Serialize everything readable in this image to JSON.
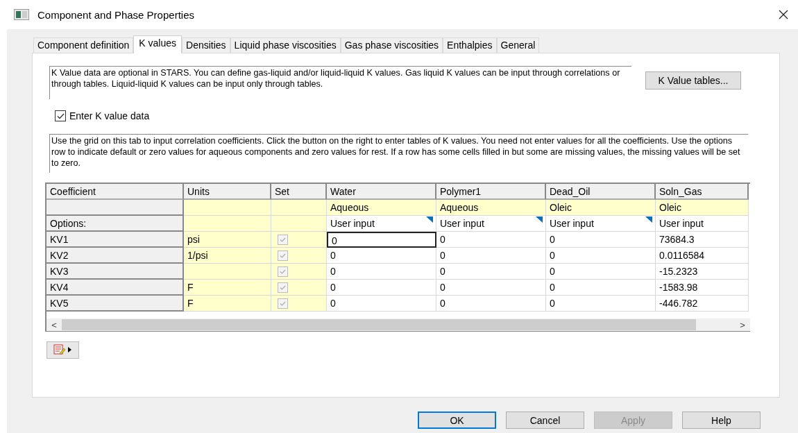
{
  "window": {
    "title": "Component and Phase Properties"
  },
  "tabs": [
    {
      "label": "Component definition",
      "selected": false
    },
    {
      "label": "K values",
      "selected": true
    },
    {
      "label": "Densities",
      "selected": false
    },
    {
      "label": "Liquid phase viscosities",
      "selected": false
    },
    {
      "label": "Gas phase viscosities",
      "selected": false
    },
    {
      "label": "Enthalpies",
      "selected": false
    },
    {
      "label": "General",
      "selected": false
    }
  ],
  "intro": "K Value data are optional in STARS. You can define gas-liquid and/or liquid-liquid K values. Gas liquid K values can be input through correlations or through tables. Liquid-liquid K values can be input only through tables.",
  "tables_button": "K Value tables...",
  "enter_checkbox": {
    "label": "Enter K value data",
    "checked": true
  },
  "grid_help": "Use the grid on this tab to input correlation coefficients. Click the button on the right to enter tables of K values. You need not enter values for all the coefficients. Use the options row to indicate default or zero values for aqueous components and zero values for rest. If a row has some cells filled in but some are missing values, the missing values will be set to zero.",
  "grid": {
    "fixed_headers": [
      "Coefficient",
      "Units",
      "Set"
    ],
    "options_label": "Options:",
    "components": [
      {
        "name": "Water",
        "phase": "Aqueous",
        "option": "User input",
        "dropdown": true
      },
      {
        "name": "Polymer1",
        "phase": "Aqueous",
        "option": "User input",
        "dropdown": true
      },
      {
        "name": "Dead_Oil",
        "phase": "Oleic",
        "option": "User input",
        "dropdown": true
      },
      {
        "name": "Soln_Gas",
        "phase": "Oleic",
        "option": "User input",
        "dropdown": false
      }
    ],
    "rows": [
      {
        "name": "KV1",
        "units": "psi",
        "checked": true,
        "values": [
          {
            "text": "0",
            "selected": true
          },
          {
            "text": "0",
            "selected": false
          },
          {
            "text": "0",
            "selected": false
          },
          {
            "text": "73684.3",
            "selected": false
          }
        ]
      },
      {
        "name": "KV2",
        "units": "1/psi",
        "checked": true,
        "values": [
          {
            "text": "0",
            "selected": false
          },
          {
            "text": "0",
            "selected": false
          },
          {
            "text": "0",
            "selected": false
          },
          {
            "text": "0.0116584",
            "selected": false
          }
        ]
      },
      {
        "name": "KV3",
        "checked": true,
        "values": [
          {
            "text": "0",
            "selected": false
          },
          {
            "text": "0",
            "selected": false
          },
          {
            "text": "0",
            "selected": false
          },
          {
            "text": "-15.2323",
            "selected": false
          }
        ]
      },
      {
        "name": "KV4",
        "units": "F",
        "checked": true,
        "values": [
          {
            "text": "0",
            "selected": false
          },
          {
            "text": "0",
            "selected": false
          },
          {
            "text": "0",
            "selected": false
          },
          {
            "text": "-1583.98",
            "selected": false
          }
        ]
      },
      {
        "name": "KV5",
        "units": "F",
        "checked": true,
        "values": [
          {
            "text": "0",
            "selected": false
          },
          {
            "text": "0",
            "selected": false
          },
          {
            "text": "0",
            "selected": false
          },
          {
            "text": "-446.782",
            "selected": false
          }
        ]
      }
    ],
    "scroll_left": "<",
    "scroll_right": ">"
  },
  "buttons": [
    {
      "label": "OK",
      "default": true,
      "disabled": false
    },
    {
      "label": "Cancel",
      "default": false,
      "disabled": false
    },
    {
      "label": "Apply",
      "default": false,
      "disabled": true
    },
    {
      "label": "Help",
      "default": false,
      "disabled": false
    }
  ]
}
